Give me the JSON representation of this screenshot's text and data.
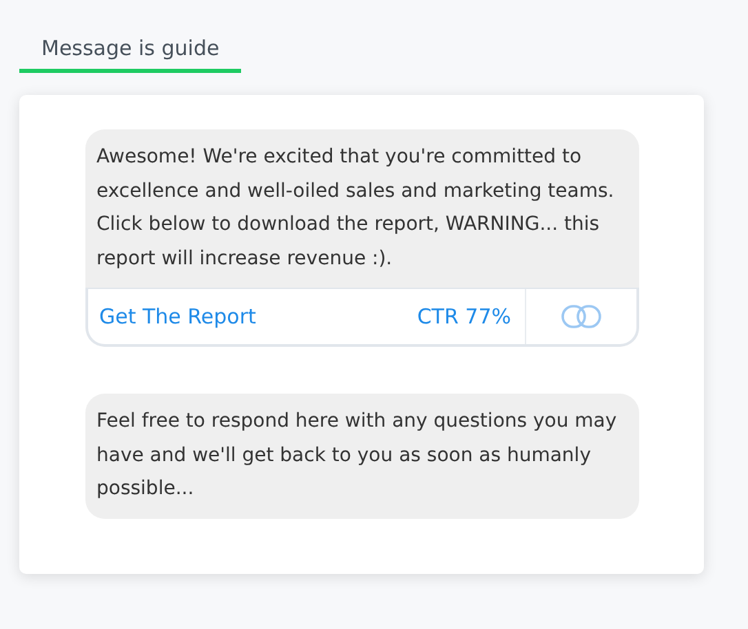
{
  "tabs": [
    {
      "label": "Message is guide",
      "selected": true
    }
  ],
  "messages": [
    {
      "text": "Awesome! We're excited that you're committed to excellence and well-oiled sales and marketing teams. Click below to download the report, WARNING... this report will increase revenue :).",
      "buttons": [
        {
          "label": "Get The Report",
          "ctr": "CTR 77%"
        }
      ]
    },
    {
      "text": "Feel free to respond here with any questions you may have and we'll get back to you as soon as humanly possible..."
    }
  ]
}
